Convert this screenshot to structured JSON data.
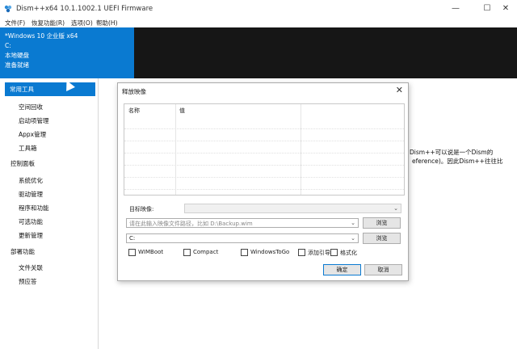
{
  "titlebar": {
    "title": "Dism++x64 10.1.1002.1 UEFI Firmware",
    "minimize": "—",
    "maximize": "☐",
    "close": "✕"
  },
  "menu": {
    "items": [
      "文件(F)",
      "恢复功能(R)",
      "选项(O)",
      "帮助(H)"
    ]
  },
  "infopanel": {
    "os": "*Windows 10 企业版 x64",
    "drive": "C:",
    "disk": "本地硬盘",
    "status": "准备就绪"
  },
  "sidebar": {
    "selected": "常用工具",
    "group1": [
      "空间回收",
      "启动项管理",
      "Appx管理",
      "工具箱"
    ],
    "section2": "控制面板",
    "group2": [
      "系统优化",
      "驱动管理",
      "程序和功能",
      "可选功能",
      "更新管理"
    ],
    "section3": "部署功能",
    "group3": [
      "文件关联",
      "预应答"
    ]
  },
  "background": {
    "line1": "Dism++可以说是一个Dism的",
    "line2": "eference)。因此Dism++往往比"
  },
  "dialog": {
    "title": "释放映像",
    "close": "✕",
    "columns": [
      "名称",
      "值"
    ],
    "target_label": "目标映像:",
    "target_value": "",
    "path_placeholder": "请在此输入映像文件路径，比如 D:\\Backup.wim",
    "browse1": "浏览",
    "drive_value": "C:",
    "browse2": "浏览",
    "checks": [
      "WIMBoot",
      "Compact",
      "WindowsToGo",
      "添加引导",
      "格式化"
    ],
    "ok": "确定",
    "cancel": "取消"
  },
  "colors": {
    "accent": "#0a7ad1",
    "dark": "#161616"
  }
}
